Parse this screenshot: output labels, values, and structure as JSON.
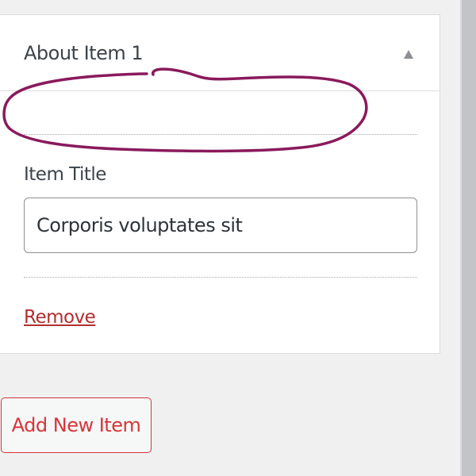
{
  "item_panel": {
    "title": "About Item 1",
    "toggle_icon": "triangle-up-icon",
    "field_label": "Item Title",
    "field_value": "Corporis voluptates sit",
    "remove_label": "Remove"
  },
  "add_item_button": {
    "label": "Add New Item"
  },
  "colors": {
    "page_background": "#f0f0f1",
    "panel_background": "#ffffff",
    "remove_link": "#b32d2e",
    "add_button": "#d63638",
    "annotation_stroke": "#8a1a5c"
  }
}
